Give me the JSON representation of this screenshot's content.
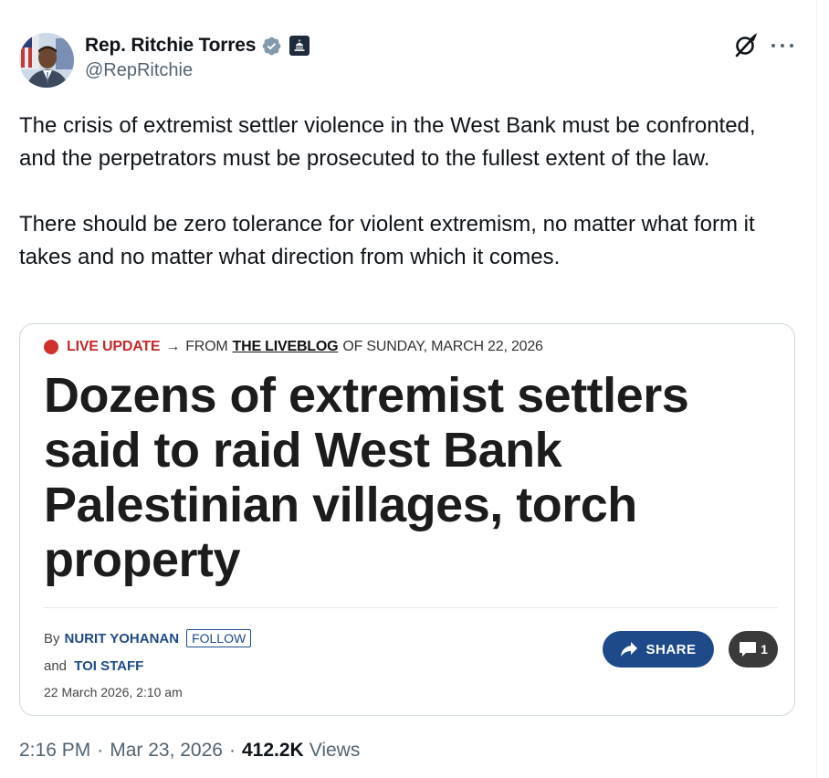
{
  "author": {
    "name": "Rep. Ritchie Torres",
    "handle": "@RepRitchie",
    "verified_color": "#829aab",
    "affiliate_badge": "us-capitol-icon"
  },
  "tweet": {
    "paragraphs": [
      "The crisis of extremist settler violence in the West Bank must be confronted, and the perpetrators must be prosecuted to the fullest extent of the law.",
      "There should be zero tolerance for violent extremism, no matter what form it takes and no matter what direction from which it comes."
    ]
  },
  "card": {
    "live_label": "LIVE UPDATE",
    "arrow": "→",
    "from_text": "FROM",
    "liveblog_link": "THE LIVEBLOG",
    "date_text": "OF SUNDAY, MARCH 22, 2026",
    "headline": "Dozens of extremist settlers said to raid West Bank Palestinian villages, torch property",
    "by_label": "By",
    "author1": "NURIT YOHANAN",
    "follow_label": "FOLLOW",
    "and_label": "and",
    "author2": "TOI STAFF",
    "published": "22 March 2026, 2:10 am",
    "share_label": "SHARE",
    "comment_count": "1",
    "accent_color": "#1e4a8a",
    "live_color": "#c42a2a"
  },
  "meta": {
    "time": "2:16 PM",
    "sep1": "·",
    "date": "Mar 23, 2026",
    "sep2": "·",
    "views_count": "412.2K",
    "views_label": "Views"
  }
}
